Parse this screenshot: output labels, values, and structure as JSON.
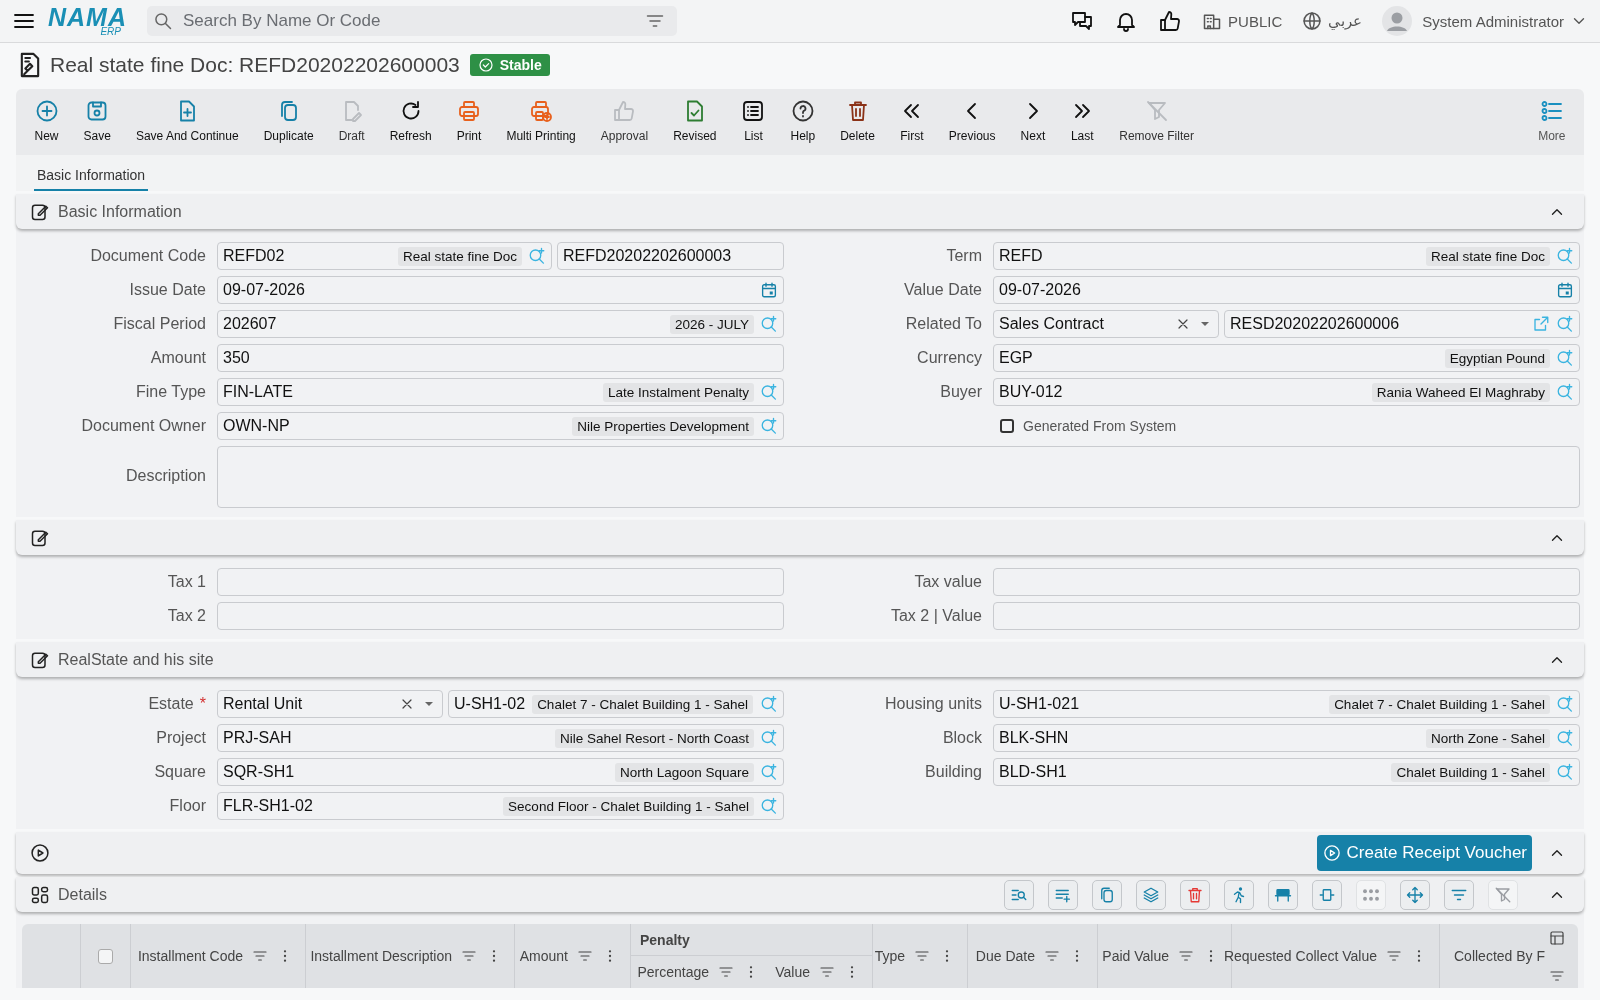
{
  "topbar": {
    "logo": "NAMA",
    "logo_sub": "ERP",
    "search": {
      "placeholder": "Search By Name Or Code"
    },
    "company": "PUBLIC",
    "language": "عربي",
    "user": "System Administrator"
  },
  "document": {
    "title": "Real state fine Doc: REFD20202202600003",
    "status": "Stable"
  },
  "toolbar": [
    {
      "label": "New",
      "kind": "plus-circle",
      "disabled": false
    },
    {
      "label": "Save",
      "kind": "floppy",
      "disabled": false
    },
    {
      "label": "Save And Continue",
      "kind": "file-plus",
      "disabled": false
    },
    {
      "label": "Duplicate",
      "kind": "copy",
      "disabled": false
    },
    {
      "label": "Draft",
      "kind": "file-pencil",
      "disabled": true
    },
    {
      "label": "Refresh",
      "kind": "refresh",
      "disabled": false
    },
    {
      "label": "Print",
      "kind": "printer",
      "disabled": false
    },
    {
      "label": "Multi Printing",
      "kind": "printer-plus",
      "disabled": false
    },
    {
      "label": "Approval",
      "kind": "thumbs-up",
      "disabled": true
    },
    {
      "label": "Revised",
      "kind": "file-check",
      "disabled": false
    },
    {
      "label": "List",
      "kind": "list",
      "disabled": false
    },
    {
      "label": "Help",
      "kind": "help",
      "disabled": false
    },
    {
      "label": "Delete",
      "kind": "trash",
      "disabled": false
    },
    {
      "label": "First",
      "kind": "double-left",
      "disabled": false
    },
    {
      "label": "Previous",
      "kind": "chevron-left",
      "disabled": false
    },
    {
      "label": "Next",
      "kind": "chevron-right",
      "disabled": false
    },
    {
      "label": "Last",
      "kind": "double-right",
      "disabled": false
    },
    {
      "label": "Remove Filter",
      "kind": "filter-off",
      "disabled": true
    }
  ],
  "more": "More",
  "tabs": [
    {
      "label": "Basic Information",
      "selected": true
    }
  ],
  "sections": [
    {
      "title": "Basic Information",
      "expanded": true,
      "left": [
        {
          "label": "Document Code",
          "kind": "pair",
          "value": "REFD02",
          "desc": "Real state fine Doc",
          "value2": "REFD20202202600003"
        },
        {
          "label": "Issue Date",
          "kind": "date",
          "value": "09-07-2026"
        },
        {
          "label": "Fiscal Period",
          "kind": "lookup",
          "value": "202607",
          "desc": "2026 - JULY"
        },
        {
          "label": "Amount",
          "kind": "text",
          "value": "350"
        },
        {
          "label": "Fine Type",
          "kind": "lookup",
          "value": "FIN-LATE",
          "desc": "Late Instalment Penalty"
        },
        {
          "label": "Document Owner",
          "kind": "lookup",
          "value": "OWN-NP",
          "desc": "Nile Properties Development"
        }
      ],
      "right": [
        {
          "label": "Term",
          "kind": "lookup",
          "value": "REFD",
          "desc": "Real state fine Doc"
        },
        {
          "label": "Value Date",
          "kind": "date",
          "value": "09-07-2026"
        },
        {
          "label": "Related To",
          "kind": "select-pair",
          "select": "Sales Contract",
          "value": "RESD20202202600006",
          "link": true
        },
        {
          "label": "Currency",
          "kind": "lookup",
          "value": "EGP",
          "desc": "Egyptian Pound"
        },
        {
          "label": "Buyer",
          "kind": "lookup",
          "value": "BUY-012",
          "desc": "Rania Waheed El Maghraby"
        },
        {
          "label": "Generated From System",
          "kind": "checkbox",
          "checked": false
        }
      ],
      "wide": [
        {
          "label": "Description",
          "kind": "textarea"
        }
      ]
    },
    {
      "expanded": true,
      "left": [
        {
          "label": "Tax 1",
          "kind": "text"
        },
        {
          "label": "Tax 2",
          "kind": "text"
        }
      ],
      "right": [
        {
          "label": "Tax value",
          "kind": "text"
        },
        {
          "label": "Tax 2 | Value",
          "kind": "text"
        }
      ]
    },
    {
      "title": "RealState and his site",
      "expanded": true,
      "left": [
        {
          "label": "Estate",
          "required_mark": "*",
          "kind": "select-pair",
          "select": "Rental Unit",
          "value": "U-SH1-02",
          "desc": "Chalet 7 - Chalet Building 1 - Sahel"
        },
        {
          "label": "Project",
          "kind": "lookup",
          "value": "PRJ-SAH",
          "desc": "Nile Sahel Resort - North Coast"
        },
        {
          "label": "Square",
          "kind": "lookup",
          "value": "SQR-SH1",
          "desc": "North Lagoon Square"
        },
        {
          "label": "Floor",
          "kind": "lookup",
          "value": "FLR-SH1-02",
          "desc": "Second Floor - Chalet Building 1 - Sahel"
        }
      ],
      "right": [
        {
          "label": "Housing units",
          "kind": "lookup",
          "value": "U-SH1-021",
          "desc": "Chalet 7 - Chalet Building 1 - Sahel"
        },
        {
          "label": "Block",
          "kind": "lookup",
          "value": "BLK-SHN",
          "desc": "North Zone - Sahel"
        },
        {
          "label": "Building",
          "kind": "lookup",
          "value": "BLD-SH1",
          "desc": "Chalet Building 1 - Sahel"
        }
      ]
    }
  ],
  "action_section": {
    "button": "Create Receipt Voucher",
    "expanded": true
  },
  "details": {
    "title": "Details",
    "expanded": true,
    "tools": [
      {
        "kind": "search-list",
        "disabled": false
      },
      {
        "kind": "add-row",
        "disabled": false
      },
      {
        "kind": "copy",
        "disabled": false
      },
      {
        "kind": "layers",
        "disabled": false
      },
      {
        "kind": "trash",
        "disabled": false
      },
      {
        "kind": "runner",
        "disabled": false
      },
      {
        "kind": "bench",
        "disabled": false
      },
      {
        "kind": "resize",
        "disabled": false
      },
      {
        "kind": "dots",
        "disabled": true
      },
      {
        "kind": "move",
        "disabled": false
      },
      {
        "kind": "filter",
        "disabled": false
      },
      {
        "kind": "filter-off",
        "disabled": true
      }
    ],
    "select_all": {
      "checked": false
    },
    "columns": [
      {
        "label": "Installment Code"
      },
      {
        "label": "Installment Description"
      },
      {
        "label": "Amount"
      },
      {
        "label": "Penalty",
        "children": [
          {
            "label": "Percentage"
          },
          {
            "label": "Value"
          }
        ]
      },
      {
        "label": "Type"
      },
      {
        "label": "Due Date"
      },
      {
        "label": "Paid Value"
      },
      {
        "label": "Requested Collect Value"
      },
      {
        "label": "Collected By F"
      }
    ]
  }
}
